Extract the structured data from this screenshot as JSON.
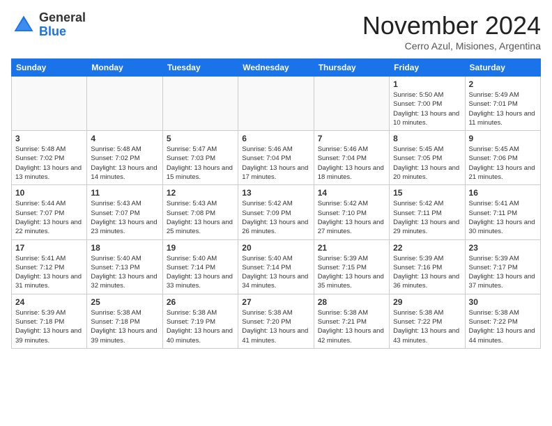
{
  "header": {
    "logo_line1": "General",
    "logo_line2": "Blue",
    "month": "November 2024",
    "location": "Cerro Azul, Misiones, Argentina"
  },
  "weekdays": [
    "Sunday",
    "Monday",
    "Tuesday",
    "Wednesday",
    "Thursday",
    "Friday",
    "Saturday"
  ],
  "weeks": [
    [
      {
        "day": "",
        "empty": true
      },
      {
        "day": "",
        "empty": true
      },
      {
        "day": "",
        "empty": true
      },
      {
        "day": "",
        "empty": true
      },
      {
        "day": "",
        "empty": true
      },
      {
        "day": "1",
        "sunrise": "Sunrise: 5:50 AM",
        "sunset": "Sunset: 7:00 PM",
        "daylight": "Daylight: 13 hours and 10 minutes."
      },
      {
        "day": "2",
        "sunrise": "Sunrise: 5:49 AM",
        "sunset": "Sunset: 7:01 PM",
        "daylight": "Daylight: 13 hours and 11 minutes."
      }
    ],
    [
      {
        "day": "3",
        "sunrise": "Sunrise: 5:48 AM",
        "sunset": "Sunset: 7:02 PM",
        "daylight": "Daylight: 13 hours and 13 minutes."
      },
      {
        "day": "4",
        "sunrise": "Sunrise: 5:48 AM",
        "sunset": "Sunset: 7:02 PM",
        "daylight": "Daylight: 13 hours and 14 minutes."
      },
      {
        "day": "5",
        "sunrise": "Sunrise: 5:47 AM",
        "sunset": "Sunset: 7:03 PM",
        "daylight": "Daylight: 13 hours and 15 minutes."
      },
      {
        "day": "6",
        "sunrise": "Sunrise: 5:46 AM",
        "sunset": "Sunset: 7:04 PM",
        "daylight": "Daylight: 13 hours and 17 minutes."
      },
      {
        "day": "7",
        "sunrise": "Sunrise: 5:46 AM",
        "sunset": "Sunset: 7:04 PM",
        "daylight": "Daylight: 13 hours and 18 minutes."
      },
      {
        "day": "8",
        "sunrise": "Sunrise: 5:45 AM",
        "sunset": "Sunset: 7:05 PM",
        "daylight": "Daylight: 13 hours and 20 minutes."
      },
      {
        "day": "9",
        "sunrise": "Sunrise: 5:45 AM",
        "sunset": "Sunset: 7:06 PM",
        "daylight": "Daylight: 13 hours and 21 minutes."
      }
    ],
    [
      {
        "day": "10",
        "sunrise": "Sunrise: 5:44 AM",
        "sunset": "Sunset: 7:07 PM",
        "daylight": "Daylight: 13 hours and 22 minutes."
      },
      {
        "day": "11",
        "sunrise": "Sunrise: 5:43 AM",
        "sunset": "Sunset: 7:07 PM",
        "daylight": "Daylight: 13 hours and 23 minutes."
      },
      {
        "day": "12",
        "sunrise": "Sunrise: 5:43 AM",
        "sunset": "Sunset: 7:08 PM",
        "daylight": "Daylight: 13 hours and 25 minutes."
      },
      {
        "day": "13",
        "sunrise": "Sunrise: 5:42 AM",
        "sunset": "Sunset: 7:09 PM",
        "daylight": "Daylight: 13 hours and 26 minutes."
      },
      {
        "day": "14",
        "sunrise": "Sunrise: 5:42 AM",
        "sunset": "Sunset: 7:10 PM",
        "daylight": "Daylight: 13 hours and 27 minutes."
      },
      {
        "day": "15",
        "sunrise": "Sunrise: 5:42 AM",
        "sunset": "Sunset: 7:11 PM",
        "daylight": "Daylight: 13 hours and 29 minutes."
      },
      {
        "day": "16",
        "sunrise": "Sunrise: 5:41 AM",
        "sunset": "Sunset: 7:11 PM",
        "daylight": "Daylight: 13 hours and 30 minutes."
      }
    ],
    [
      {
        "day": "17",
        "sunrise": "Sunrise: 5:41 AM",
        "sunset": "Sunset: 7:12 PM",
        "daylight": "Daylight: 13 hours and 31 minutes."
      },
      {
        "day": "18",
        "sunrise": "Sunrise: 5:40 AM",
        "sunset": "Sunset: 7:13 PM",
        "daylight": "Daylight: 13 hours and 32 minutes."
      },
      {
        "day": "19",
        "sunrise": "Sunrise: 5:40 AM",
        "sunset": "Sunset: 7:14 PM",
        "daylight": "Daylight: 13 hours and 33 minutes."
      },
      {
        "day": "20",
        "sunrise": "Sunrise: 5:40 AM",
        "sunset": "Sunset: 7:14 PM",
        "daylight": "Daylight: 13 hours and 34 minutes."
      },
      {
        "day": "21",
        "sunrise": "Sunrise: 5:39 AM",
        "sunset": "Sunset: 7:15 PM",
        "daylight": "Daylight: 13 hours and 35 minutes."
      },
      {
        "day": "22",
        "sunrise": "Sunrise: 5:39 AM",
        "sunset": "Sunset: 7:16 PM",
        "daylight": "Daylight: 13 hours and 36 minutes."
      },
      {
        "day": "23",
        "sunrise": "Sunrise: 5:39 AM",
        "sunset": "Sunset: 7:17 PM",
        "daylight": "Daylight: 13 hours and 37 minutes."
      }
    ],
    [
      {
        "day": "24",
        "sunrise": "Sunrise: 5:39 AM",
        "sunset": "Sunset: 7:18 PM",
        "daylight": "Daylight: 13 hours and 39 minutes."
      },
      {
        "day": "25",
        "sunrise": "Sunrise: 5:38 AM",
        "sunset": "Sunset: 7:18 PM",
        "daylight": "Daylight: 13 hours and 39 minutes."
      },
      {
        "day": "26",
        "sunrise": "Sunrise: 5:38 AM",
        "sunset": "Sunset: 7:19 PM",
        "daylight": "Daylight: 13 hours and 40 minutes."
      },
      {
        "day": "27",
        "sunrise": "Sunrise: 5:38 AM",
        "sunset": "Sunset: 7:20 PM",
        "daylight": "Daylight: 13 hours and 41 minutes."
      },
      {
        "day": "28",
        "sunrise": "Sunrise: 5:38 AM",
        "sunset": "Sunset: 7:21 PM",
        "daylight": "Daylight: 13 hours and 42 minutes."
      },
      {
        "day": "29",
        "sunrise": "Sunrise: 5:38 AM",
        "sunset": "Sunset: 7:22 PM",
        "daylight": "Daylight: 13 hours and 43 minutes."
      },
      {
        "day": "30",
        "sunrise": "Sunrise: 5:38 AM",
        "sunset": "Sunset: 7:22 PM",
        "daylight": "Daylight: 13 hours and 44 minutes."
      }
    ]
  ]
}
